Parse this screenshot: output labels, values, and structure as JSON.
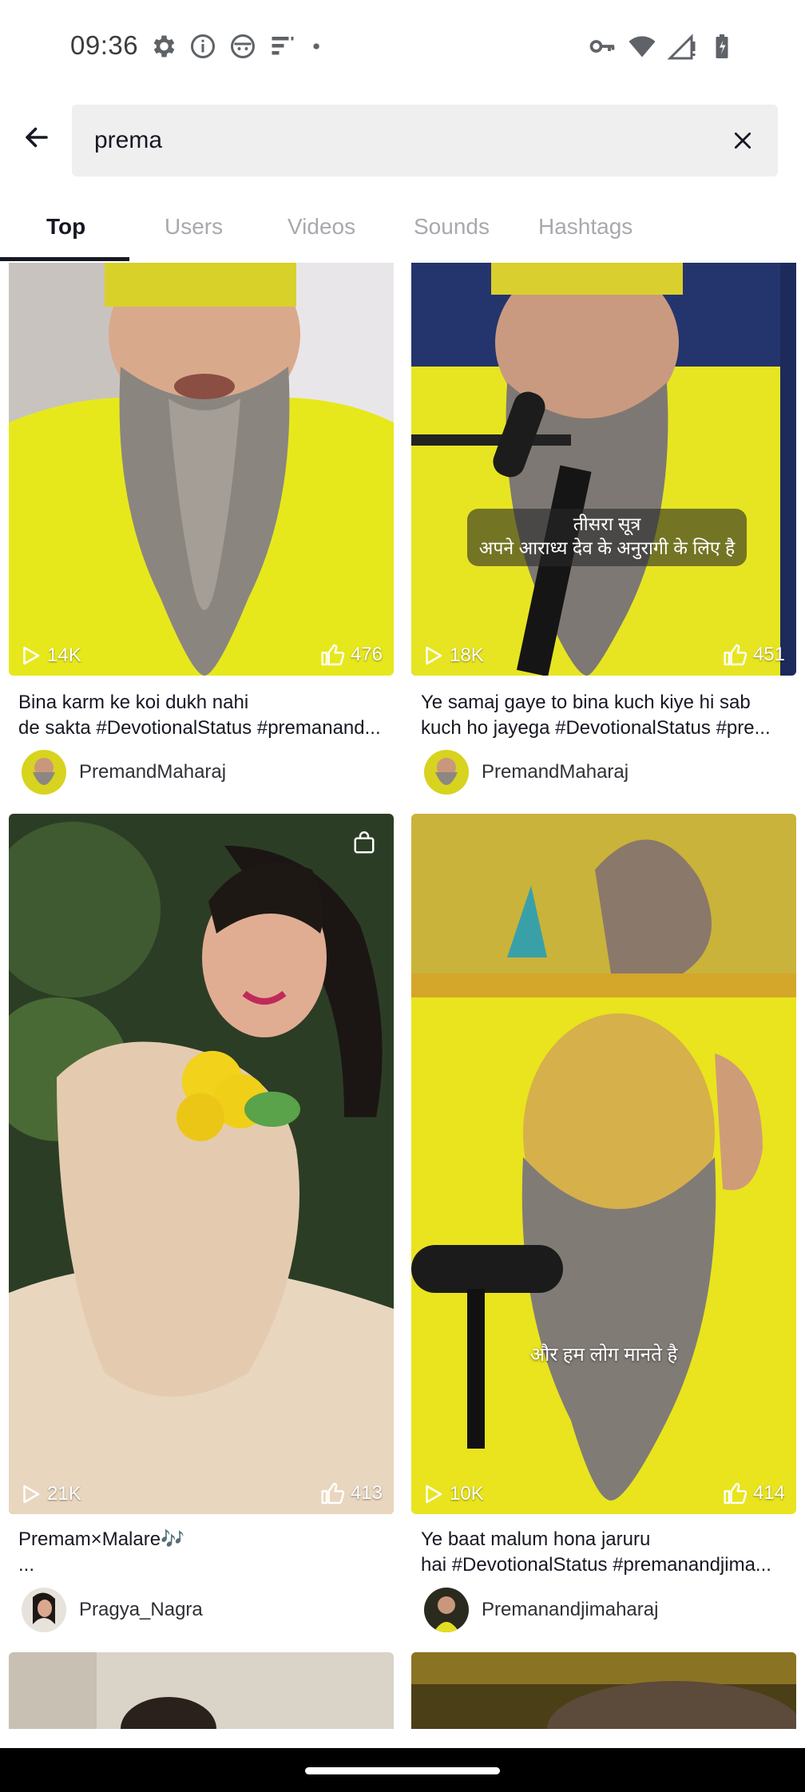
{
  "status_bar": {
    "time": "09:36",
    "left_icons": [
      "settings-icon",
      "info-icon",
      "app-face-icon",
      "signal-bars-icon",
      "dot-icon"
    ],
    "right_icons": [
      "vpn-key-icon",
      "wifi-icon",
      "cell-signal-icon",
      "battery-icon"
    ]
  },
  "search": {
    "query": "prema",
    "back_icon": "arrow-left-icon",
    "clear_icon": "close-icon"
  },
  "tabs": [
    {
      "label": "Top",
      "active": true
    },
    {
      "label": "Users",
      "active": false
    },
    {
      "label": "Videos",
      "active": false
    },
    {
      "label": "Sounds",
      "active": false
    },
    {
      "label": "Hashtags",
      "active": false
    }
  ],
  "results": [
    {
      "plays": "14K",
      "likes": "476",
      "caption": "Bina karm ke koi dukh nahi\nde sakta #DevotionalStatus #premanand...",
      "author": "PremandMaharaj"
    },
    {
      "plays": "18K",
      "likes": "451",
      "caption": "Ye samaj gaye to bina kuch kiye hi sab\nkuch ho jayega #DevotionalStatus #pre...",
      "author": "PremandMaharaj",
      "overlay_line1": "तीसरा सूत्र",
      "overlay_line2": "अपने आराध्य देव के अनुरागी के लिए है"
    },
    {
      "plays": "21K",
      "likes": "413",
      "caption": "Premam×Malare🎶\n...",
      "author": "Pragya_Nagra",
      "shop_icon": "shopping-bag-icon"
    },
    {
      "plays": "10K",
      "likes": "414",
      "caption": "Ye baat malum hona jaruru\nhai #DevotionalStatus #premanandjima...",
      "author": "Premanandjimaharaj",
      "overlay_line1": "और हम लोग मानते है"
    }
  ],
  "colors": {
    "text_primary": "#161823",
    "tab_inactive": "#a8a9ae",
    "search_bg": "#efeff0",
    "robe_yellow": "#e8e81a"
  }
}
